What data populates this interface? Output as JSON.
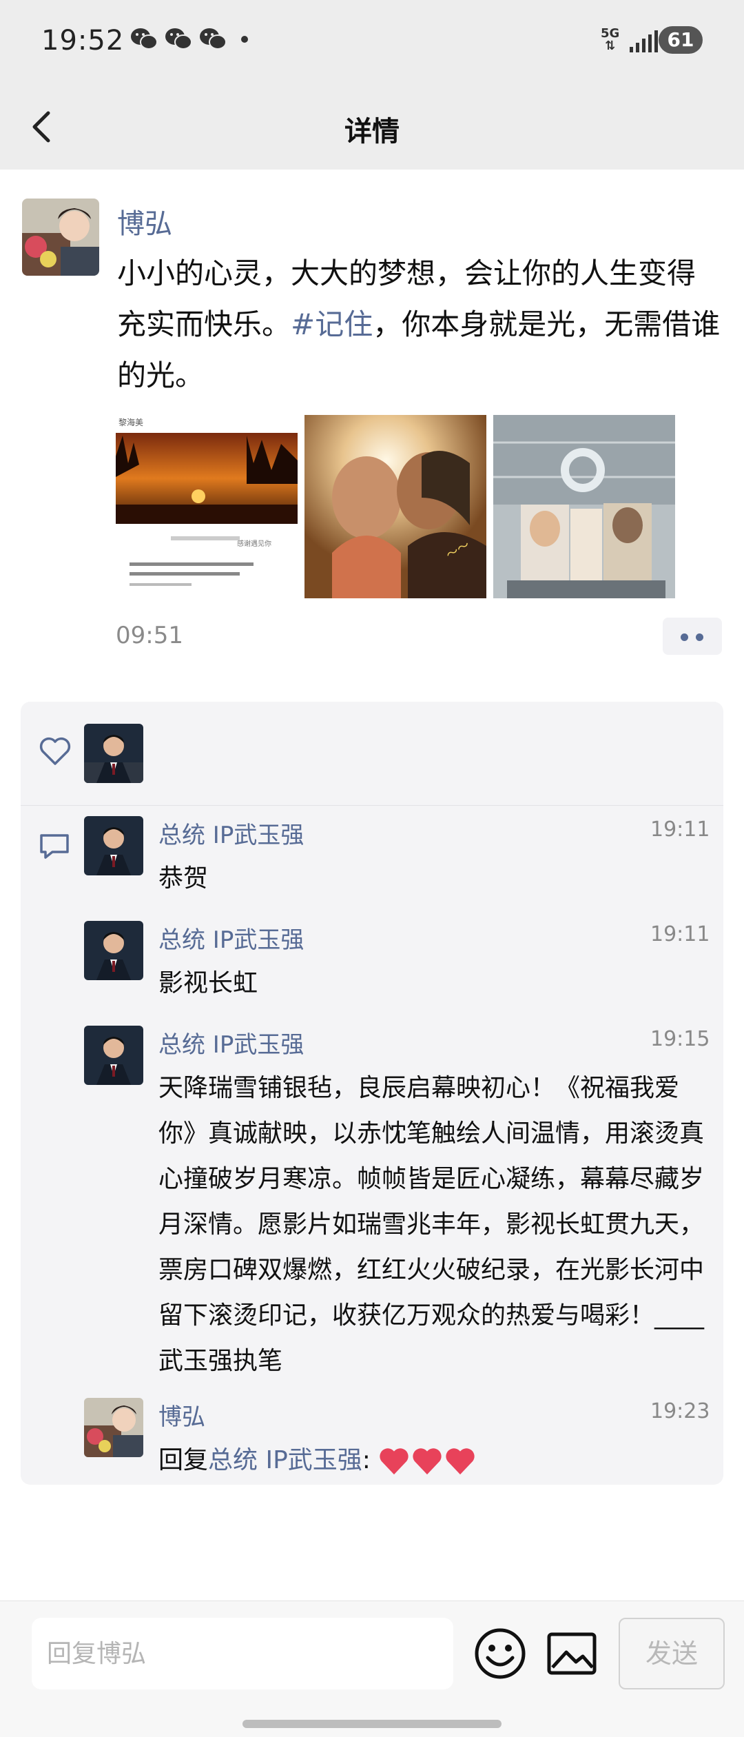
{
  "status_bar": {
    "time": "19:52",
    "network": "5G",
    "battery": "61"
  },
  "nav": {
    "title": "详情"
  },
  "post": {
    "author": "博弘",
    "text_before_tag": "小小的心灵，大大的梦想，会让你的人生变得充实而快乐。",
    "tag": "#记住",
    "text_after_tag": "，你本身就是光，无需借谁的光。",
    "time": "09:51",
    "photo1_header": "黎海美",
    "photo1_caption": "感谢遇见你"
  },
  "comments": [
    {
      "name": "总统 IP武玉强",
      "time": "19:11",
      "text": "恭贺"
    },
    {
      "name": "总统 IP武玉强",
      "time": "19:11",
      "text": "影视长虹"
    },
    {
      "name": "总统 IP武玉强",
      "time": "19:15",
      "text": "天降瑞雪铺银毡，良辰启幕映初心！《祝福我爱你》真诚献映，以赤忱笔触绘人间温情，用滚烫真心撞破岁月寒凉。帧帧皆是匠心凝练，幕幕尽藏岁月深情。愿影片如瑞雪兆丰年，影视长虹贯九天，票房口碑双爆燃，红红火火破纪录，在光影长河中留下滚烫印记，收获亿万观众的热爱与喝彩！____武玉强执笔"
    },
    {
      "name": "博弘",
      "time": "19:23",
      "reply_prefix": "回复",
      "reply_target": "总统 IP武玉强",
      "reply_colon": ":"
    }
  ],
  "input": {
    "placeholder": "回复博弘"
  },
  "send_label": "发送",
  "colors": {
    "link": "#576b95",
    "background_top": "#ededed",
    "comment_bg": "#f4f4f6",
    "heart": "#e8425a"
  },
  "icons": [
    "back-icon",
    "wechat-icon",
    "heart-icon",
    "comment-icon",
    "more-icon",
    "emoji-icon",
    "image-icon"
  ]
}
